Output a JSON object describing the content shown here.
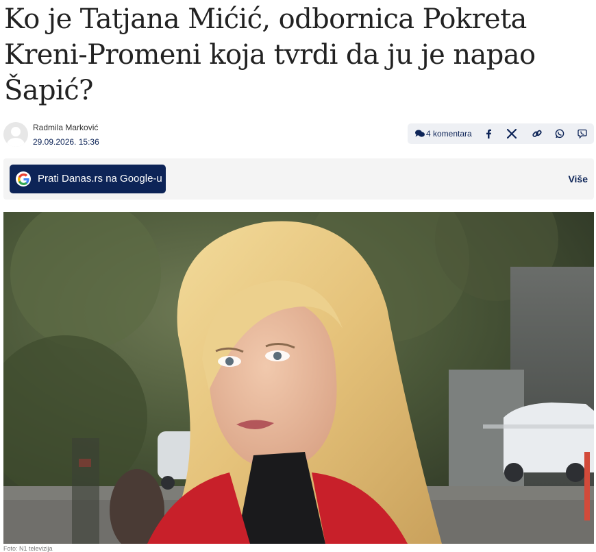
{
  "article": {
    "title": "Ko je Tatjana Mićić, odbornica Pokreta Kreni-Promeni koja tvrdi da ju je napao Šapić?",
    "author": "Radmila Marković",
    "date": "29.09.2026. 15:36",
    "photo_caption": "Foto: N1 televizija"
  },
  "share": {
    "comments_label": "4 komentara",
    "icons": [
      "facebook-icon",
      "x-icon",
      "link-icon",
      "whatsapp-icon",
      "viber-icon"
    ]
  },
  "follow": {
    "google_button_label": "Prati Danas.rs na Google-u",
    "more_label": "Više"
  },
  "colors": {
    "brand": "#0d2457",
    "panel": "#f4f4f4",
    "share_bar": "#eef0f4"
  }
}
